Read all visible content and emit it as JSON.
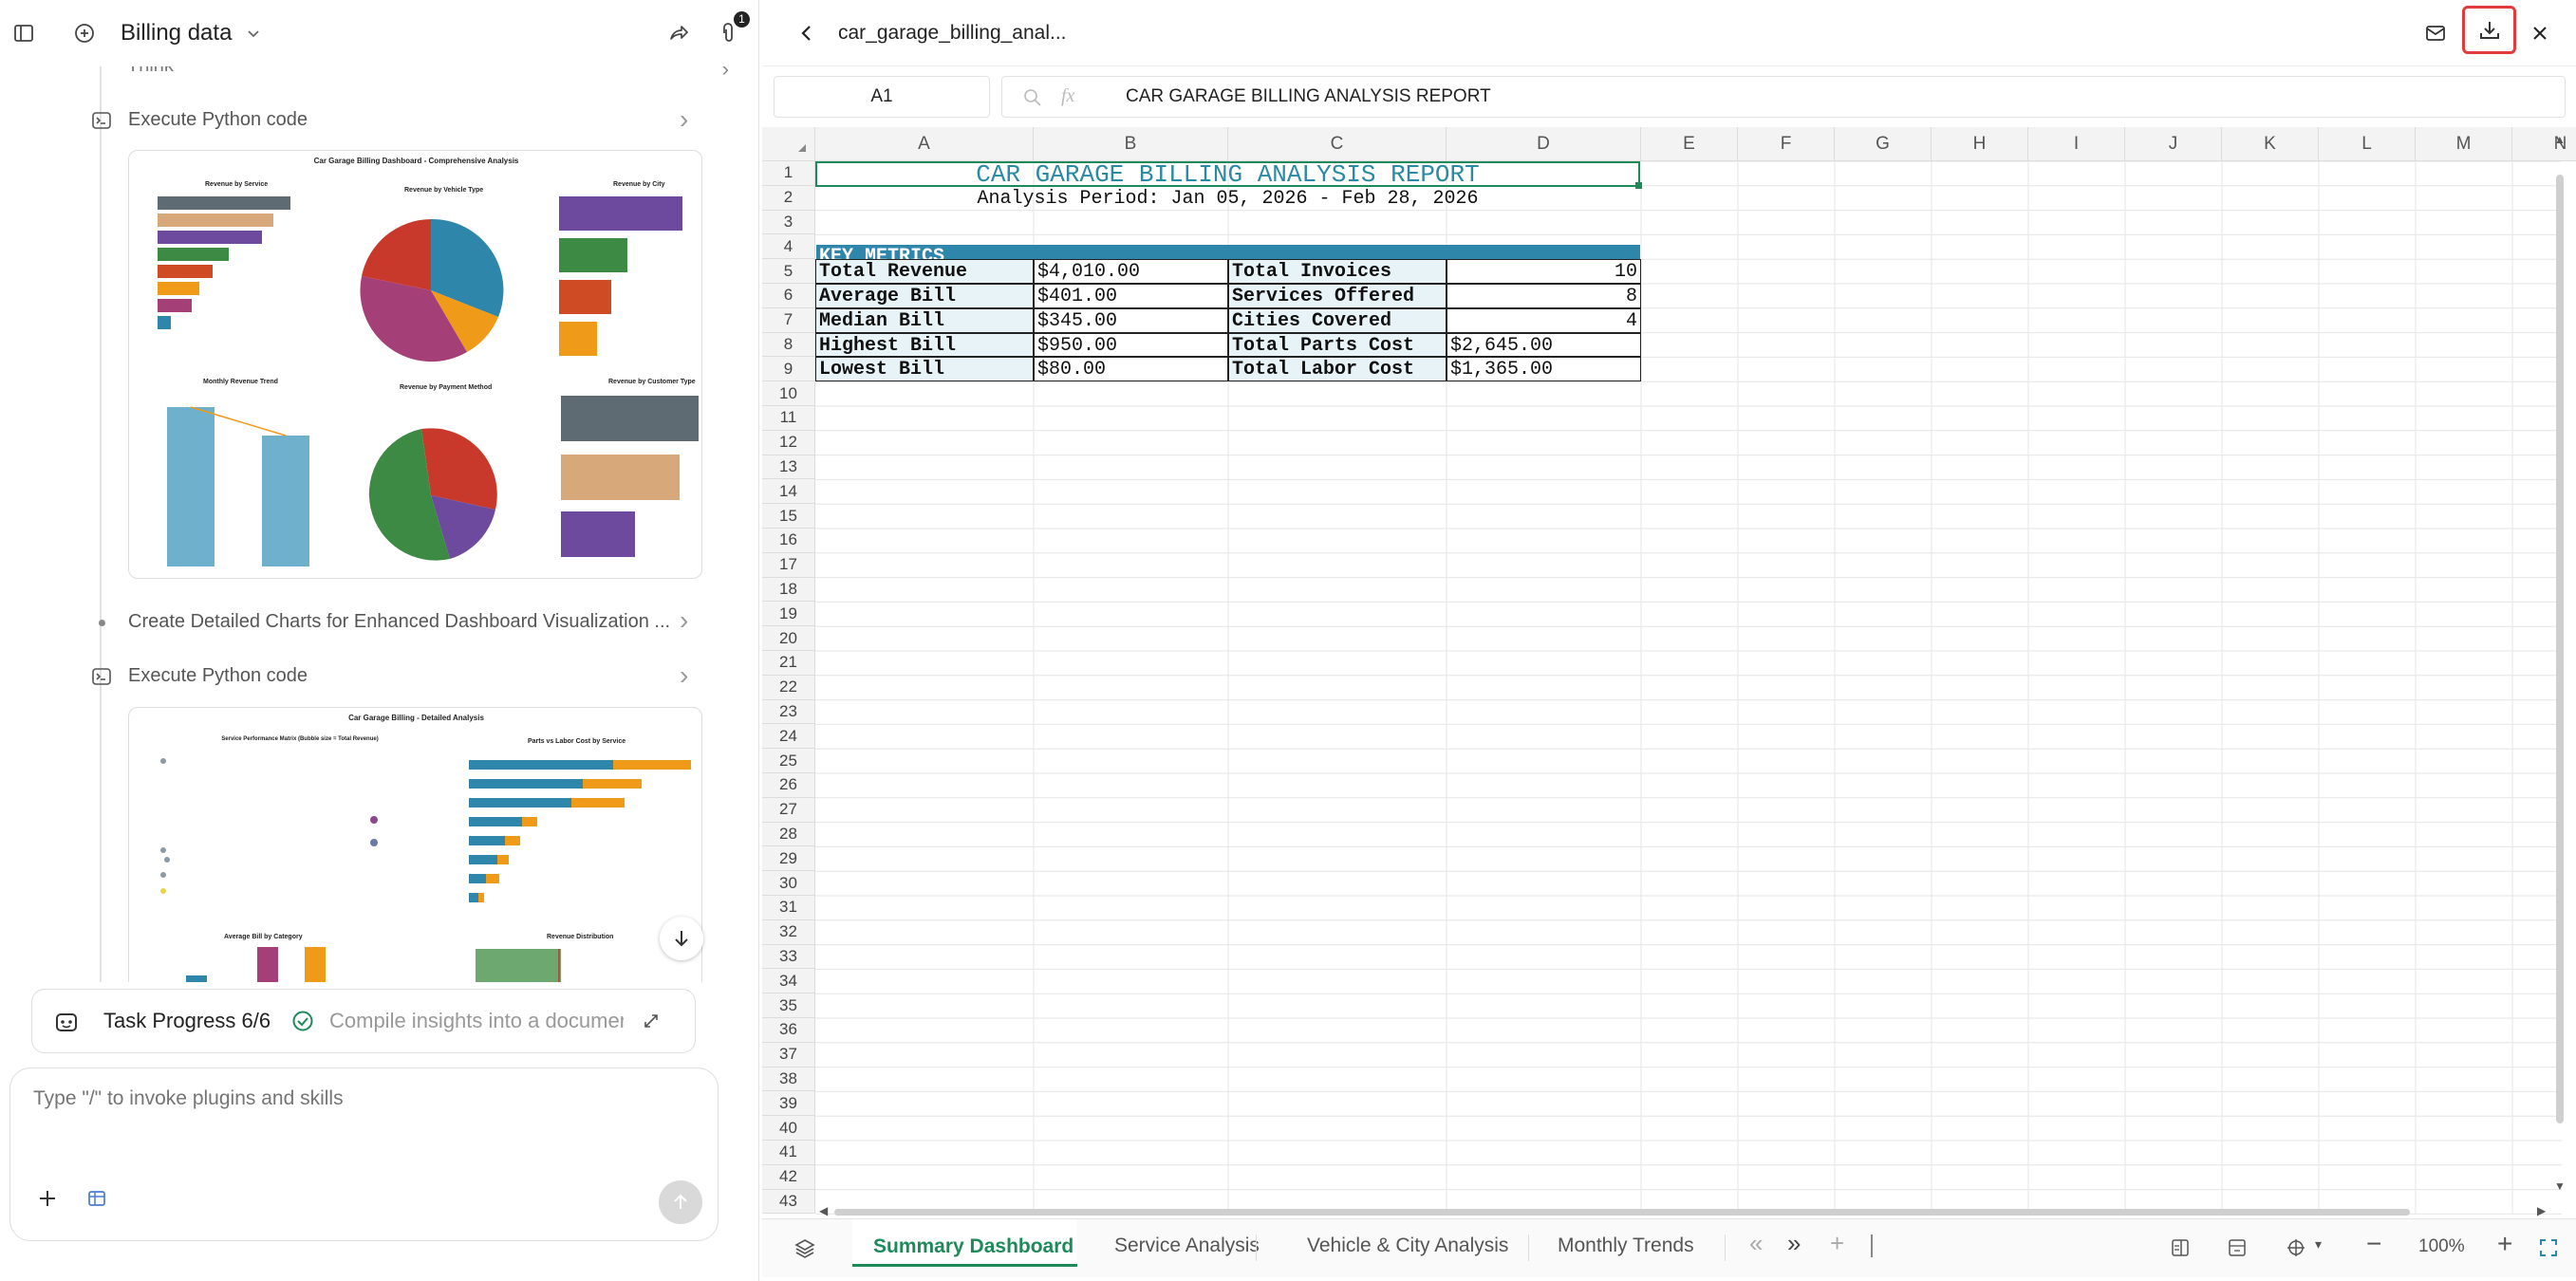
{
  "left": {
    "title": "Billing data",
    "attach_badge": "1",
    "think_label": "Think",
    "step1": "Execute Python code",
    "step2": "Create Detailed Charts for Enhanced Dashboard Visualization ...",
    "step3": "Execute Python code",
    "chart1": {
      "title": "Car Garage Billing Dashboard - Comprehensive Analysis",
      "p1": "Revenue by Service",
      "p2": "Revenue by Vehicle Type",
      "p3": "Revenue by City",
      "p4": "Monthly Revenue Trend",
      "p5": "Revenue by Payment Method",
      "p6": "Revenue by Customer Type"
    },
    "chart2": {
      "title": "Car Garage Billing - Detailed Analysis",
      "p1": "Service Performance Matrix (Bubble size = Total Revenue)",
      "p2": "Parts vs Labor Cost by Service",
      "p3": "Average Bill by Category",
      "p4": "Revenue Distribution"
    },
    "task_label": "Task Progress 6/6",
    "task_status": "Compile insights into a documer",
    "input_placeholder": "Type \"/\" to invoke plugins and skills"
  },
  "sheet": {
    "filename": "car_garage_billing_anal...",
    "cell_ref": "A1",
    "formula": "CAR GARAGE BILLING ANALYSIS REPORT",
    "columns": [
      "A",
      "B",
      "C",
      "D",
      "E",
      "F",
      "G",
      "H",
      "I",
      "J",
      "K",
      "L",
      "M",
      "N"
    ],
    "rows": [
      "1",
      "2",
      "3",
      "4",
      "5",
      "6",
      "7",
      "8",
      "9",
      "10",
      "11",
      "12",
      "13",
      "14",
      "15",
      "16",
      "17",
      "18",
      "19",
      "20",
      "21",
      "22",
      "23",
      "24",
      "25",
      "26",
      "27",
      "28",
      "29",
      "30",
      "31",
      "32",
      "33",
      "34",
      "35",
      "36",
      "37",
      "38",
      "39",
      "40",
      "41",
      "42",
      "43"
    ],
    "report_title": "CAR GARAGE BILLING ANALYSIS REPORT",
    "period": "Analysis Period: Jan 05, 2026 - Feb 28, 2026",
    "section": "KEY METRICS",
    "metrics": [
      {
        "l1": "Total Revenue",
        "v1": "$4,010.00",
        "l2": "Total Invoices",
        "v2": "10"
      },
      {
        "l1": "Average Bill",
        "v1": "$401.00",
        "l2": "Services Offered",
        "v2": "8"
      },
      {
        "l1": "Median Bill",
        "v1": "$345.00",
        "l2": "Cities Covered",
        "v2": "4"
      },
      {
        "l1": "Highest Bill",
        "v1": "$950.00",
        "l2": "Total Parts Cost",
        "v2": "$2,645.00"
      },
      {
        "l1": "Lowest Bill",
        "v1": "$80.00",
        "l2": "Total Labor Cost",
        "v2": "$1,365.00"
      }
    ],
    "tabs": [
      "Summary Dashboard",
      "Service Analysis",
      "Vehicle & City Analysis",
      "Monthly Trends"
    ],
    "zoom": "100%"
  },
  "colors": {
    "accent_green": "#1e8a5a",
    "header_blue": "#2e86ab",
    "title_teal": "#2a8aa3",
    "highlight_red": "#e23b3b"
  }
}
